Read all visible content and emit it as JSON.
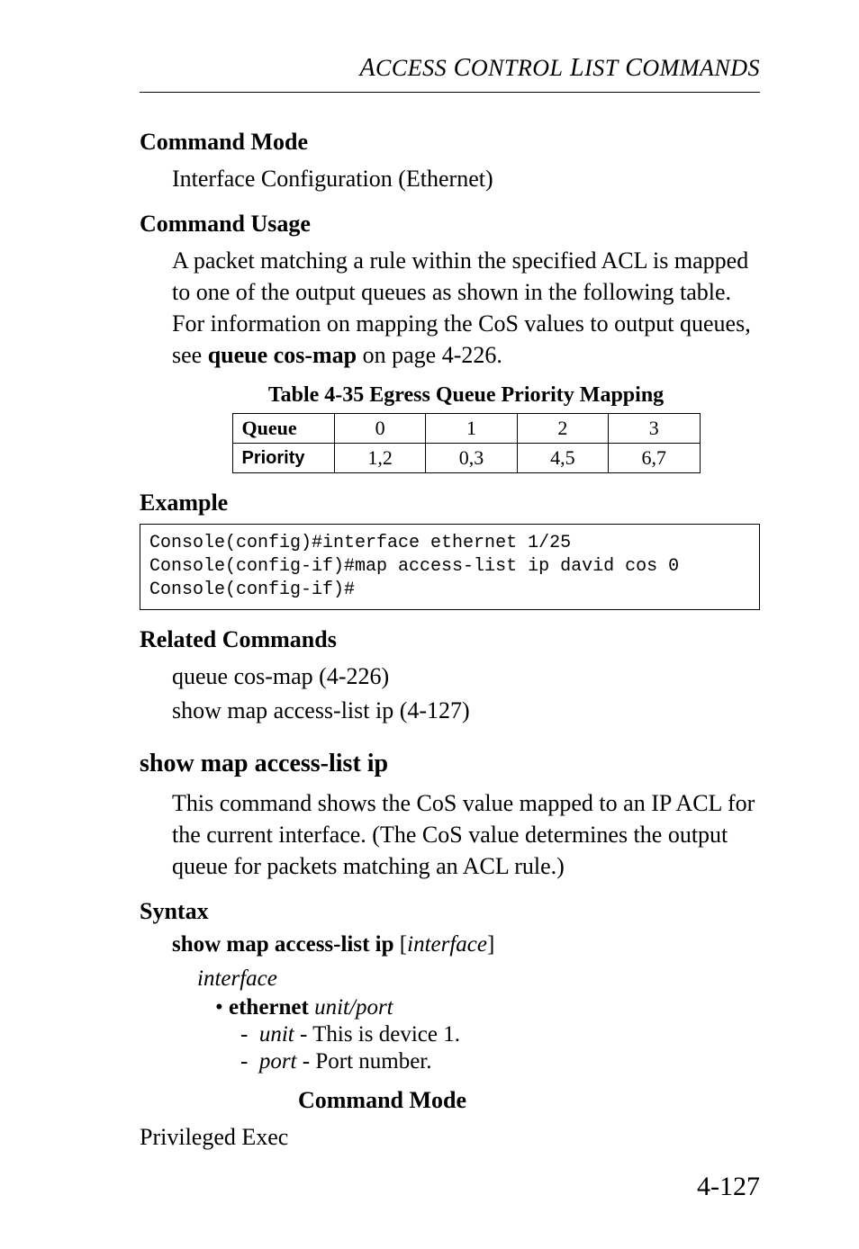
{
  "running_head": {
    "text_parts": [
      "A",
      "CCESS",
      " C",
      "ONTROL",
      " L",
      "IST",
      " C",
      "OMMANDS"
    ]
  },
  "sections": {
    "cmd_mode_h": "Command Mode",
    "cmd_mode_body": "Interface Configuration (Ethernet)",
    "cmd_usage_h": "Command Usage",
    "cmd_usage_body_1": "A packet matching a rule within the specified ACL is mapped to one of the output queues as shown in the following table. For information on mapping the CoS values to output queues, see ",
    "cmd_usage_body_bold": "queue cos-map",
    "cmd_usage_body_2": " on page 4-226.",
    "table_caption": "Table 4-35  Egress Queue Priority Mapping",
    "table": {
      "row1_head": "Queue",
      "row1": [
        "0",
        "1",
        "2",
        "3"
      ],
      "row2_head": "Priority",
      "row2": [
        "1,2",
        "0,3",
        "4,5",
        "6,7"
      ]
    },
    "example_h": "Example",
    "example_code": "Console(config)#interface ethernet 1/25\nConsole(config-if)#map access-list ip david cos 0\nConsole(config-if)#",
    "related_h": "Related Commands",
    "related_1": "queue cos-map (4-226)",
    "related_2": "show map access-list ip (4-127)",
    "cmd2_title": "show map access-list ip",
    "cmd2_body": "This command shows the CoS value mapped to an IP ACL for the current interface. (The CoS value determines the output queue for packets matching an ACL rule.)",
    "syntax_h": "Syntax",
    "syntax_bold": "show map access-list ip",
    "syntax_ital": "interface",
    "iface_label": "interface",
    "bullet_bold": "ethernet",
    "bullet_ital": "unit/port",
    "dash1_ital": "unit",
    "dash1_rest": " - This is device 1.",
    "dash2_ital": "port",
    "dash2_rest": " - Port number.",
    "cmd_mode2_h": "Command Mode",
    "cmd_mode2_body": "Privileged Exec"
  },
  "page_number": "4-127"
}
